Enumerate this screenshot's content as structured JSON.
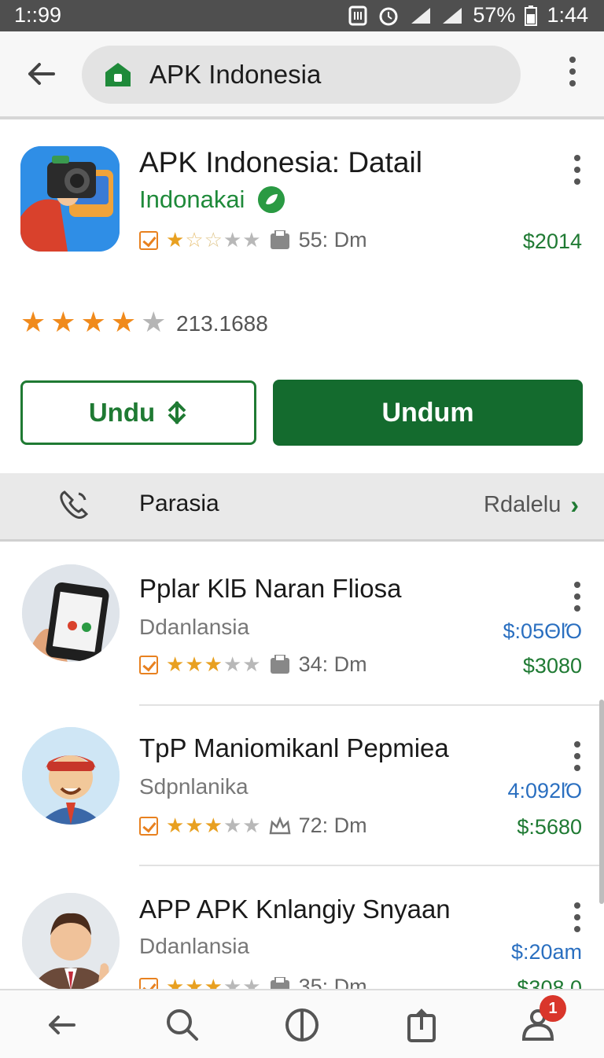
{
  "status_bar": {
    "time_left": "1::99",
    "battery": "57%",
    "time_right": "1:44"
  },
  "search": {
    "text": "APK Indonesia"
  },
  "app": {
    "title": "APK Indonesia: Datail",
    "developer": "Indonakai",
    "size": "55: Dm",
    "price": "$2014",
    "rating_value": 4.5,
    "rating_count": "213.1688",
    "btn_secondary": "Undu",
    "btn_primary": "Undum"
  },
  "section": {
    "title": "Parasia",
    "link": "Rdalelu"
  },
  "list": [
    {
      "title": "Pplar KlБ Naran Fliosa",
      "subtitle": "Ddanlansia",
      "size": "34: Dm",
      "price_top": "$:05ΘlΌ",
      "price_bottom": "$3080",
      "rating": 3.5
    },
    {
      "title": "TpP Maniomikanl Pepmiea",
      "subtitle": "Sdpnlanika",
      "size": "72: Dm",
      "price_top": "4:092lΌ",
      "price_bottom": "$:5680",
      "rating": 3.5
    },
    {
      "title": "APP APK Knlangiy Snyaan",
      "subtitle": "Ddanlansia",
      "size": "35: Dm",
      "price_top": "$:20am",
      "price_bottom": "$308 0",
      "rating": 3.5
    }
  ],
  "bottom_nav": {
    "badge_count": "1"
  },
  "colors": {
    "primary_green": "#146b2e",
    "accent_green": "#1f8a3a",
    "star_orange": "#e8811f",
    "price_blue": "#2a6fc0",
    "status_bar": "#4f4f4f"
  },
  "icons": [
    "back-arrow-icon",
    "store-icon",
    "more-vert-icon",
    "verified-leaf-icon",
    "phone-icon",
    "search-icon",
    "compass-icon",
    "share-icon",
    "profile-icon"
  ]
}
